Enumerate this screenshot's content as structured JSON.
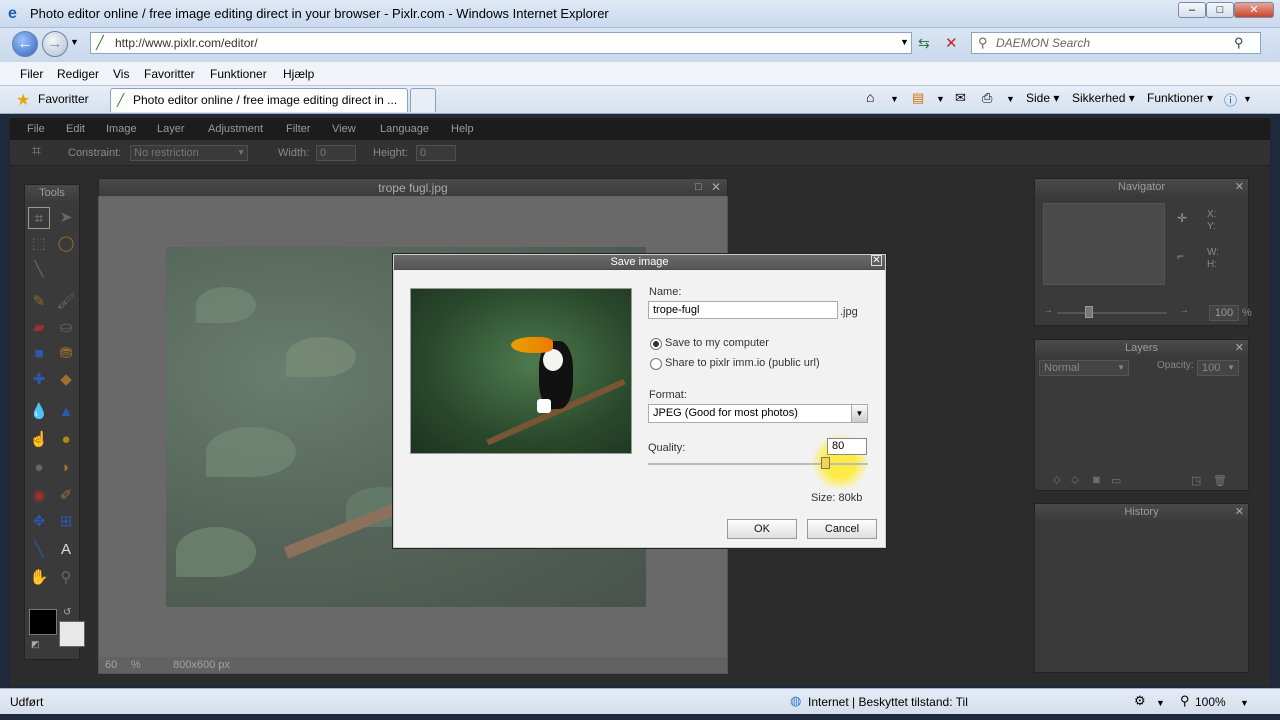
{
  "window": {
    "title": "Photo editor online / free image editing direct in your browser - Pixlr.com - Windows Internet Explorer"
  },
  "address": {
    "url": "http://www.pixlr.com/editor/",
    "search_placeholder": "DAEMON Search"
  },
  "ie_menu": [
    "Filer",
    "Rediger",
    "Vis",
    "Favoritter",
    "Funktioner",
    "Hjælp"
  ],
  "favorites_label": "Favoritter",
  "tab_title": "Photo editor online / free image editing direct in ...",
  "command_bar": {
    "page": "Side",
    "safety": "Sikkerhed",
    "tools": "Funktioner"
  },
  "pixlr_menu": [
    "File",
    "Edit",
    "Image",
    "Layer",
    "Adjustment",
    "Filter",
    "View",
    "Language",
    "Help"
  ],
  "options_bar": {
    "constraint_label": "Constraint:",
    "constraint_value": "No restriction",
    "width_label": "Width:",
    "width_value": "0",
    "height_label": "Height:",
    "height_value": "0"
  },
  "tools_panel": {
    "title": "Tools"
  },
  "image_window": {
    "title": "trope fugl.jpg",
    "zoom": "60",
    "zoom_unit": "%",
    "dimensions": "800x600 px"
  },
  "navigator": {
    "title": "Navigator",
    "x_label": "X:",
    "y_label": "Y:",
    "w_label": "W:",
    "h_label": "H:",
    "zoom": "100",
    "zoom_unit": "%"
  },
  "layers": {
    "title": "Layers",
    "blend_mode": "Normal",
    "opacity_label": "Opacity:",
    "opacity_value": "100"
  },
  "history": {
    "title": "History"
  },
  "save_dialog": {
    "title": "Save image",
    "name_label": "Name:",
    "name_value": "trope-fugl",
    "extension": ".jpg",
    "option_save": "Save to my computer",
    "option_share": "Share to pixlr imm.io (public url)",
    "selected_option": "save",
    "format_label": "Format:",
    "format_value": "JPEG (Good for most photos)",
    "quality_label": "Quality:",
    "quality_value": "80",
    "size_text": "Size: 80kb",
    "ok_label": "OK",
    "cancel_label": "Cancel"
  },
  "status": {
    "left": "Udført",
    "zone": "Internet | Beskyttet tilstand: Til",
    "zoom": "100%"
  }
}
